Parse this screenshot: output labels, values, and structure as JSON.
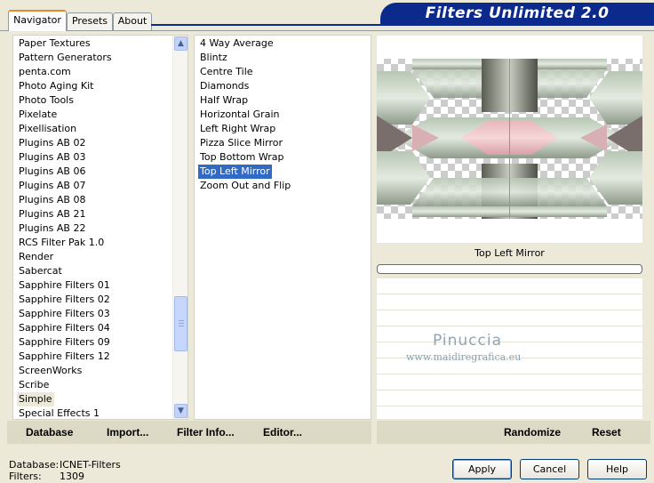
{
  "tabs": [
    "Navigator",
    "Presets",
    "About"
  ],
  "banner_title": "Filters Unlimited 2.0",
  "categories": {
    "items": [
      "Paper Textures",
      "Pattern Generators",
      "penta.com",
      "Photo Aging Kit",
      "Photo Tools",
      "Pixelate",
      "Pixellisation",
      "Plugins AB 02",
      "Plugins AB 03",
      "Plugins AB 06",
      "Plugins AB 07",
      "Plugins AB 08",
      "Plugins AB 21",
      "Plugins AB 22",
      "RCS Filter Pak 1.0",
      "Render",
      "Sabercat",
      "Sapphire Filters 01",
      "Sapphire Filters 02",
      "Sapphire Filters 03",
      "Sapphire Filters 04",
      "Sapphire Filters 09",
      "Sapphire Filters 12",
      "ScreenWorks",
      "Scribe",
      "Simple",
      "Special Effects 1"
    ],
    "selected": "Simple",
    "scroll_position": 0.75
  },
  "filters": {
    "items": [
      "4 Way Average",
      "Blintz",
      "Centre Tile",
      "Diamonds",
      "Half Wrap",
      "Horizontal Grain",
      "Left Right Wrap",
      "Pizza Slice Mirror",
      "Top Bottom Wrap",
      "Top Left Mirror",
      "Zoom Out and Flip"
    ],
    "selected": "Top Left Mirror"
  },
  "preview": {
    "filter_name": "Top Left Mirror",
    "progress": 0,
    "watermark_name": "Pinuccia",
    "watermark_url": "www.maidiregrafica.eu"
  },
  "bottom_bar": {
    "database_label": "Database",
    "import_label": "Import...",
    "filter_info_label": "Filter Info...",
    "editor_label": "Editor...",
    "randomize_label": "Randomize",
    "reset_label": "Reset"
  },
  "footer": {
    "database_key": "Database:",
    "database_value": "ICNET-Filters",
    "filters_key": "Filters:",
    "filters_value": "1309",
    "apply_label": "Apply",
    "cancel_label": "Cancel",
    "help_label": "Help"
  },
  "colors": {
    "accent": "#0b2a8c",
    "selection": "#316ac5",
    "dialog_bg": "#ece9d8"
  }
}
